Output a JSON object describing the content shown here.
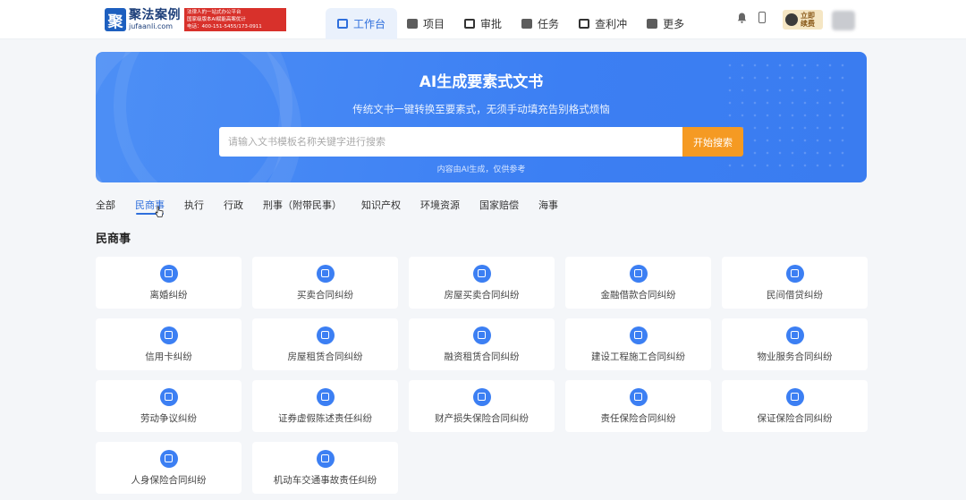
{
  "brand": {
    "mark": "聚",
    "name": "聚法案例",
    "sub": "jufaanli.com",
    "banner_line1": "法律人的一站式办公平台",
    "banner_line2": "国家级版本AI赋能高案优计",
    "banner_line3": "电话：400-151-5455/173-0911"
  },
  "nav": [
    {
      "label": "工作台",
      "icon": "monitor-icon",
      "active": true
    },
    {
      "label": "项目",
      "icon": "folder-icon",
      "active": false
    },
    {
      "label": "审批",
      "icon": "approval-icon",
      "active": false
    },
    {
      "label": "任务",
      "icon": "task-icon",
      "active": false
    },
    {
      "label": "查利冲",
      "icon": "check-icon",
      "active": false
    },
    {
      "label": "更多",
      "icon": "grid-icon",
      "active": false
    }
  ],
  "vip": {
    "line1": "立即",
    "line2": "续费"
  },
  "hero": {
    "title": "AI生成要素式文书",
    "subtitle": "传统文书一键转换至要素式，无须手动填充告别格式烦恼",
    "search_placeholder": "请输入文书模板名称关键字进行搜索",
    "search_button": "开始搜索",
    "note": "内容由AI生成，仅供参考"
  },
  "tabs": [
    {
      "label": "全部",
      "active": false
    },
    {
      "label": "民商事",
      "active": true
    },
    {
      "label": "执行",
      "active": false
    },
    {
      "label": "行政",
      "active": false
    },
    {
      "label": "刑事（附带民事）",
      "active": false
    },
    {
      "label": "知识产权",
      "active": false
    },
    {
      "label": "环境资源",
      "active": false
    },
    {
      "label": "国家赔偿",
      "active": false
    },
    {
      "label": "海事",
      "active": false
    }
  ],
  "section_title": "民商事",
  "cards": [
    {
      "label": "离婚纠纷",
      "icon": "heart-shield-icon"
    },
    {
      "label": "买卖合同纠纷",
      "icon": "shield-icon"
    },
    {
      "label": "房屋买卖合同纠纷",
      "icon": "house-icon"
    },
    {
      "label": "金融借款合同纠纷",
      "icon": "document-icon"
    },
    {
      "label": "民间借贷纠纷",
      "icon": "hand-coin-icon"
    },
    {
      "label": "信用卡纠纷",
      "icon": "card-icon"
    },
    {
      "label": "房屋租赁合同纠纷",
      "icon": "house-icon"
    },
    {
      "label": "融资租赁合同纠纷",
      "icon": "cycle-icon"
    },
    {
      "label": "建设工程施工合同纠纷",
      "icon": "building-icon"
    },
    {
      "label": "物业服务合同纠纷",
      "icon": "clipboard-icon"
    },
    {
      "label": "劳动争议纠纷",
      "icon": "briefcase-icon"
    },
    {
      "label": "证券虚假陈述责任纠纷",
      "icon": "document-icon"
    },
    {
      "label": "财产损失保险合同纠纷",
      "icon": "shield-icon"
    },
    {
      "label": "责任保险合同纠纷",
      "icon": "shield-icon"
    },
    {
      "label": "保证保险合同纠纷",
      "icon": "shield-icon"
    },
    {
      "label": "人身保险合同纠纷",
      "icon": "shield-icon"
    },
    {
      "label": "机动车交通事故责任纠纷",
      "icon": "car-icon"
    }
  ]
}
